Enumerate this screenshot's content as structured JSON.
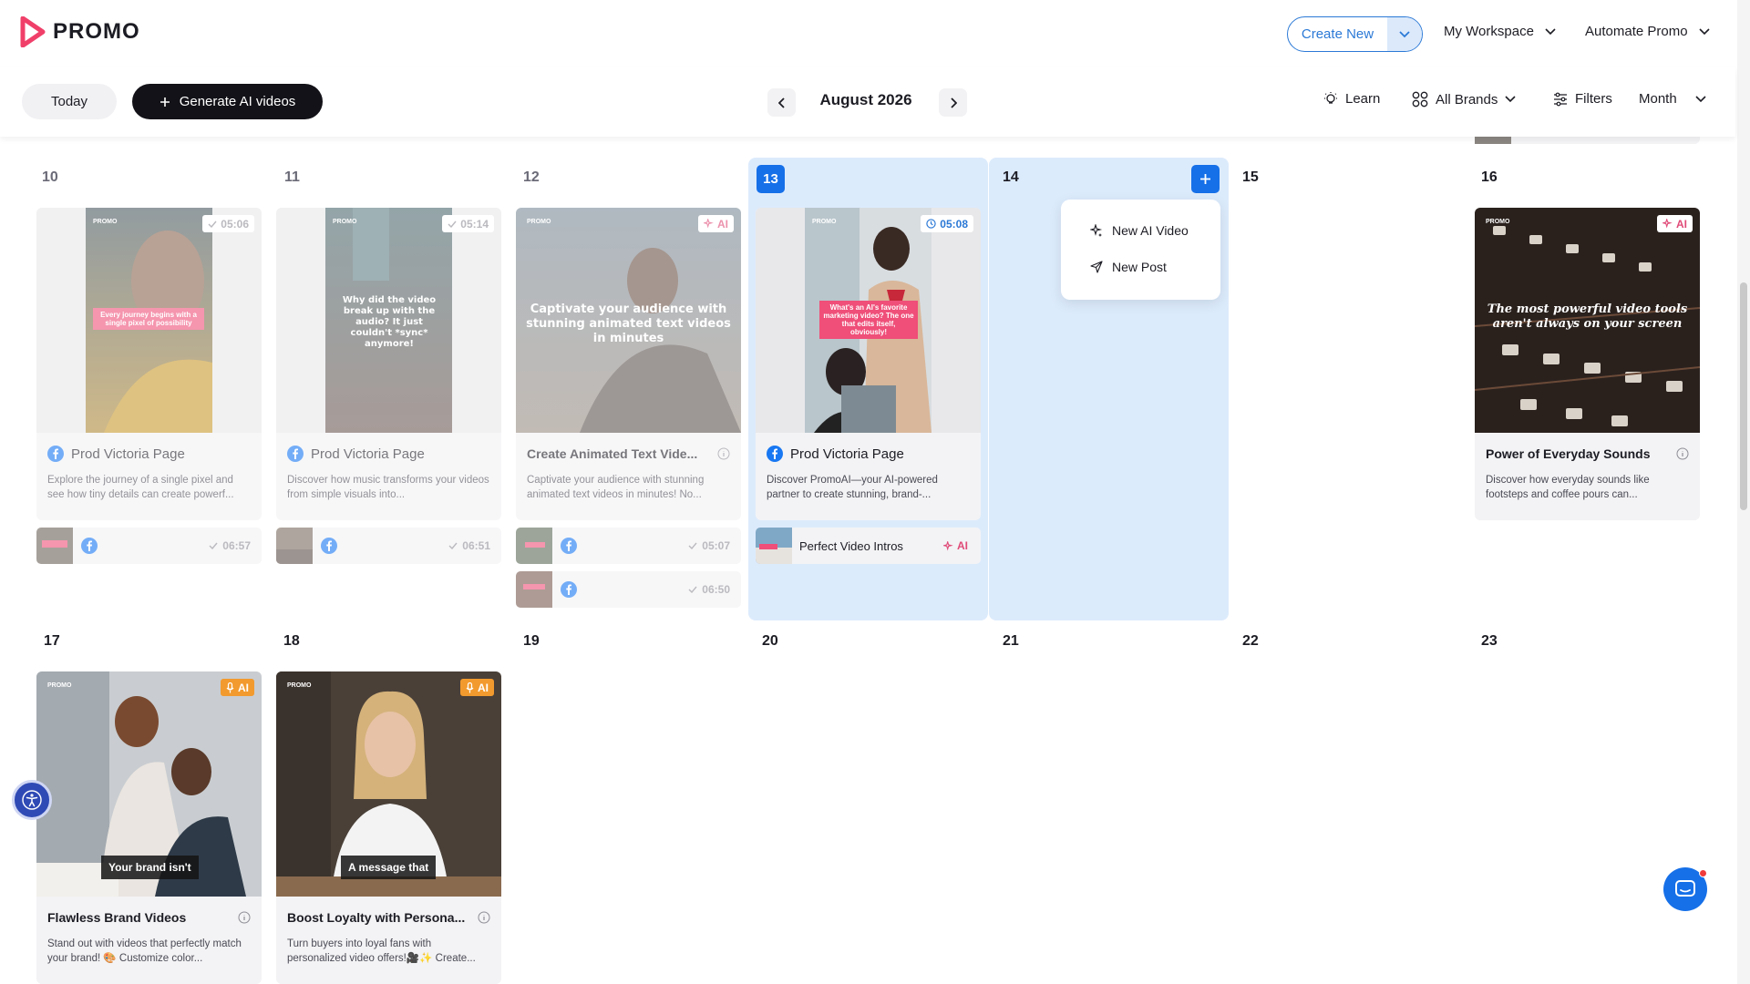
{
  "header": {
    "logo_text": "PROMO",
    "create_new": "Create New",
    "workspace": "My Workspace",
    "automate": "Automate Promo"
  },
  "toolbar": {
    "today": "Today",
    "generate": "Generate AI videos",
    "month": "August 2026",
    "learn": "Learn",
    "brands": "All Brands",
    "filters": "Filters",
    "view": "Month"
  },
  "days": {
    "d10": "10",
    "d11": "11",
    "d12": "12",
    "d13": "13",
    "d14": "14",
    "d15": "15",
    "d16": "16",
    "d17": "17",
    "d18": "18",
    "d19": "19",
    "d20": "20",
    "d21": "21",
    "d22": "22",
    "d23": "23"
  },
  "popup": {
    "new_ai_video": "New AI Video",
    "new_post": "New Post"
  },
  "cards": {
    "c10": {
      "tag": "05:06",
      "title": "Prod Victoria Page",
      "desc": "Explore the journey of a single pixel and see how tiny details can create powerf...",
      "overlay": "Every journey begins with a single pixel of possibility",
      "brand": "PROMO"
    },
    "c11": {
      "tag": "05:14",
      "title": "Prod Victoria Page",
      "desc": "Discover how music transforms your videos from simple visuals into...",
      "overlay": "Why did the video break up with the audio? It just couldn't *sync* anymore!",
      "brand": "PROMO"
    },
    "c12": {
      "tag": "AI",
      "title": "Create Animated Text Vide...",
      "desc": "Captivate your audience with stunning animated text videos in minutes! No...",
      "overlay": "Captivate your audience with stunning animated text videos in minutes",
      "brand": "PROMO"
    },
    "c13": {
      "tag": "05:08",
      "title": "Prod Victoria Page",
      "desc": "Discover PromoAI—your AI-powered partner to create stunning, brand-...",
      "overlay": "What's an AI's favorite marketing video? The one that edits itself, obviously!",
      "brand": "PROMO"
    },
    "c16": {
      "tag": "AI",
      "title": "Power of Everyday Sounds",
      "desc": "Discover how everyday sounds like footsteps and coffee pours can...",
      "overlay": "The most powerful video tools aren't always on your screen",
      "brand": "PROMO"
    },
    "c17": {
      "tag": "AI",
      "title": "Flawless Brand Videos",
      "desc": "Stand out with videos that perfectly match your brand! 🎨 Customize color...",
      "overlay": "Your brand isn't",
      "brand": "PROMO"
    },
    "c18": {
      "tag": "AI",
      "title": "Boost Loyalty with Persona...",
      "desc": "Turn buyers into loyal fans with personalized video offers!🎥✨ Create...",
      "overlay": "A message that",
      "brand": "PROMO"
    }
  },
  "subrows": {
    "s10": "06:57",
    "s11": "06:51",
    "s12a": "05:07",
    "s12b": "06:50",
    "s13_label": "Perfect Video Intros",
    "s13_tag": "AI"
  },
  "colors": {
    "accent": "#1670e8",
    "highlight": "#dcebfc",
    "ai_pink": "#e04a78",
    "ai_orange": "#f29a2e"
  }
}
